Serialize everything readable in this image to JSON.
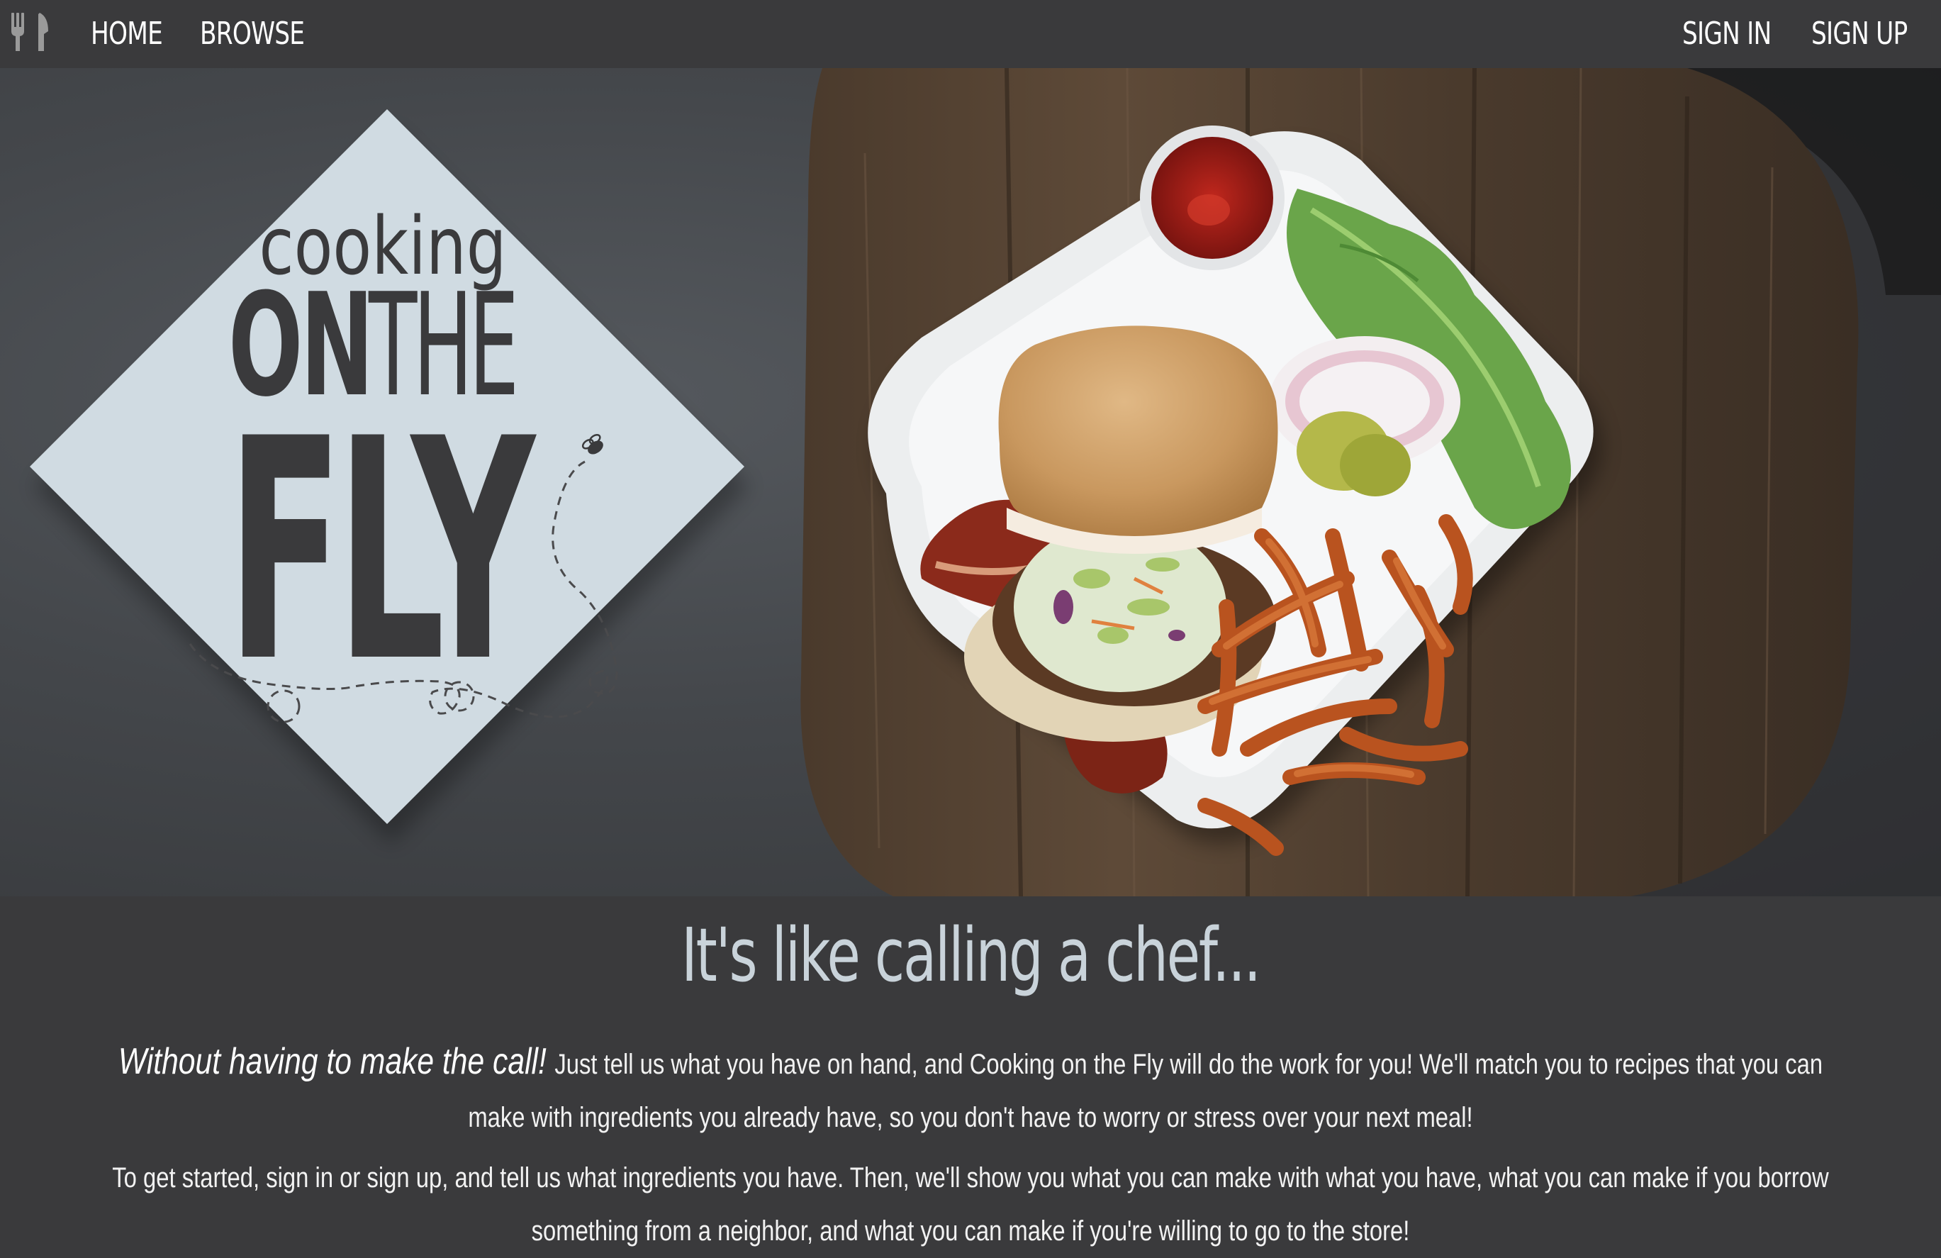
{
  "nav": {
    "brand_icon": "fork-knife-icon",
    "home": "HOME",
    "browse": "BROWSE",
    "sign_in": "SIGN IN",
    "sign_up": "SIGN UP"
  },
  "logo": {
    "line1": "cooking",
    "line2a": "ON",
    "line2b": "THE",
    "line3": "FLY"
  },
  "hero_image": "burger-with-sweet-potato-fries",
  "main": {
    "tagline": "It's like calling a chef...",
    "lead": "Without having to make the call!",
    "para1": "Just tell us what you have on hand, and Cooking on the Fly will do the work for you! We'll match you to recipes that you can make with ingredients you already have, so you don't have to worry or stress over your next meal!",
    "para2": "To get started, sign in or sign up, and tell us what ingredients you have. Then, we'll show you what you can make with what you have, what you can make if you borrow something from a neighbor, and what you can make if you're willing to go to the store!"
  },
  "colors": {
    "nav_bg": "#3a3a3c",
    "logo_bg": "#d0dbe2",
    "logo_text": "#3a3a3c",
    "tagline": "#c9d3da"
  }
}
